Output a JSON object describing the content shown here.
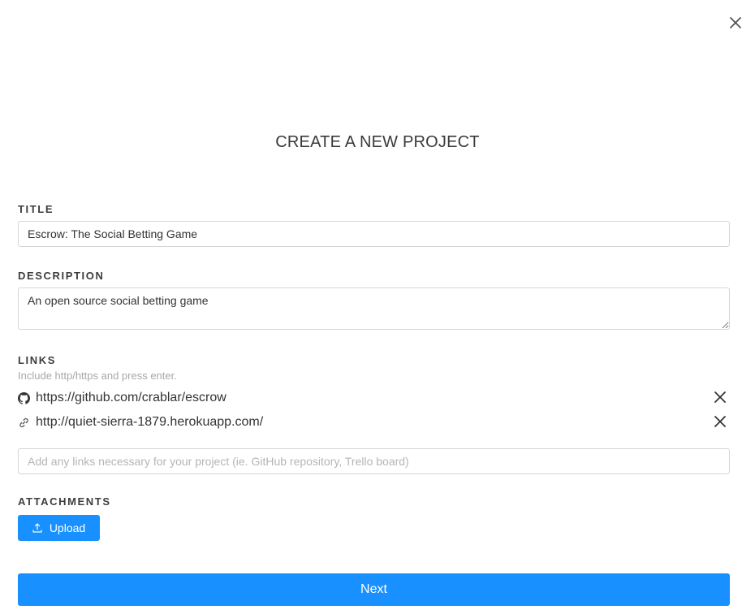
{
  "modal": {
    "title": "CREATE A NEW PROJECT",
    "close_icon": "close-icon"
  },
  "title_field": {
    "label": "TITLE",
    "value": "Escrow: The Social Betting Game"
  },
  "description_field": {
    "label": "DESCRIPTION",
    "value": "An open source social betting game"
  },
  "links": {
    "label": "LINKS",
    "helper": "Include http/https and press enter.",
    "items": [
      {
        "icon": "github-icon",
        "url": "https://github.com/crablar/escrow"
      },
      {
        "icon": "link-icon",
        "url": "http://quiet-sierra-1879.herokuapp.com/"
      }
    ],
    "input_placeholder": "Add any links necessary for your project (ie. GitHub repository, Trello board)",
    "input_value": ""
  },
  "attachments": {
    "label": "ATTACHMENTS",
    "upload_label": "Upload",
    "upload_icon": "upload-icon"
  },
  "footer": {
    "next_label": "Next"
  },
  "colors": {
    "primary": "#1890ff",
    "border": "#d6d6d6",
    "helper_text": "#a8a8a8"
  }
}
